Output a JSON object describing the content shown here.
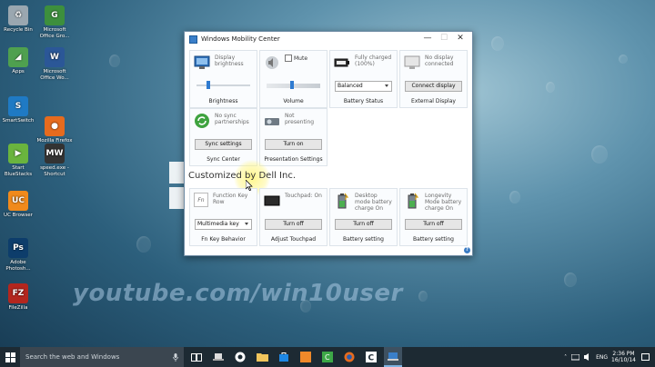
{
  "desktop": {
    "icons": [
      {
        "label": "Recycle Bin",
        "color": "#9aa7b0",
        "glyph": "♻"
      },
      {
        "label": "Microsoft Office Gro...",
        "color": "#3d8f3d",
        "glyph": "G"
      },
      {
        "label": "Apps",
        "color": "#4fa04f",
        "glyph": "◢"
      },
      {
        "label": "Microsoft Office Wo...",
        "color": "#2b5797",
        "glyph": "W"
      },
      {
        "label": "SmartSwitch",
        "color": "#1f7ac4",
        "glyph": "S"
      },
      {
        "label": "Mozilla Firefox",
        "color": "#e66b1e",
        "glyph": "●"
      },
      {
        "label": "Start BlueStacks",
        "color": "#6ab43e",
        "glyph": "▶"
      },
      {
        "label": "speed.exe - Shortcut",
        "color": "#333333",
        "glyph": "MW"
      },
      {
        "label": "UC Browser",
        "color": "#f08a1c",
        "glyph": "UC"
      },
      {
        "label": "Adobe Photosh...",
        "color": "#0d3d6b",
        "glyph": "Ps"
      },
      {
        "label": "FileZilla",
        "color": "#b3261e",
        "glyph": "FZ"
      }
    ],
    "watermark": "youtube.com/win10user"
  },
  "window": {
    "title": "Windows Mobility Center",
    "buttons": {
      "minimize": "—",
      "maximize": "☐",
      "close": "✕"
    },
    "tiles": {
      "brightness": {
        "label": "Display brightness",
        "caption": "Brightness",
        "level": 0.2
      },
      "volume": {
        "mute_label": "Mute",
        "caption": "Volume",
        "level": 0.45
      },
      "battery": {
        "label": "Fully charged (100%)",
        "select_value": "Balanced",
        "caption": "Battery Status"
      },
      "external": {
        "label": "No display connected",
        "button": "Connect display",
        "caption": "External Display"
      },
      "sync": {
        "label": "No sync partnerships",
        "button": "Sync settings",
        "caption": "Sync Center"
      },
      "presentation": {
        "label": "Not presenting",
        "button": "Turn on",
        "caption": "Presentation Settings"
      },
      "fnkey": {
        "label": "Function Key Row",
        "select_value": "Multimedia key",
        "caption": "Fn Key Behavior",
        "icon_text": "Fn"
      },
      "touchpad": {
        "label": "Touchpad: On",
        "button": "Turn off",
        "caption": "Adjust Touchpad"
      },
      "desktop_mode": {
        "label": "Desktop mode battery charge On",
        "button": "Turn off",
        "caption": "Battery setting"
      },
      "longevity": {
        "label": "Longevity Mode battery charge On",
        "button": "Turn off",
        "caption": "Battery setting"
      }
    },
    "customized_text": "Customized by Dell Inc.",
    "help": "?"
  },
  "taskbar": {
    "search_placeholder": "Search the web and Windows",
    "language": "ENG",
    "time": "2:36 PM",
    "date": "16/10/14"
  },
  "colors": {
    "accent": "#2f7bd0",
    "taskbar": "#1d2a33"
  }
}
